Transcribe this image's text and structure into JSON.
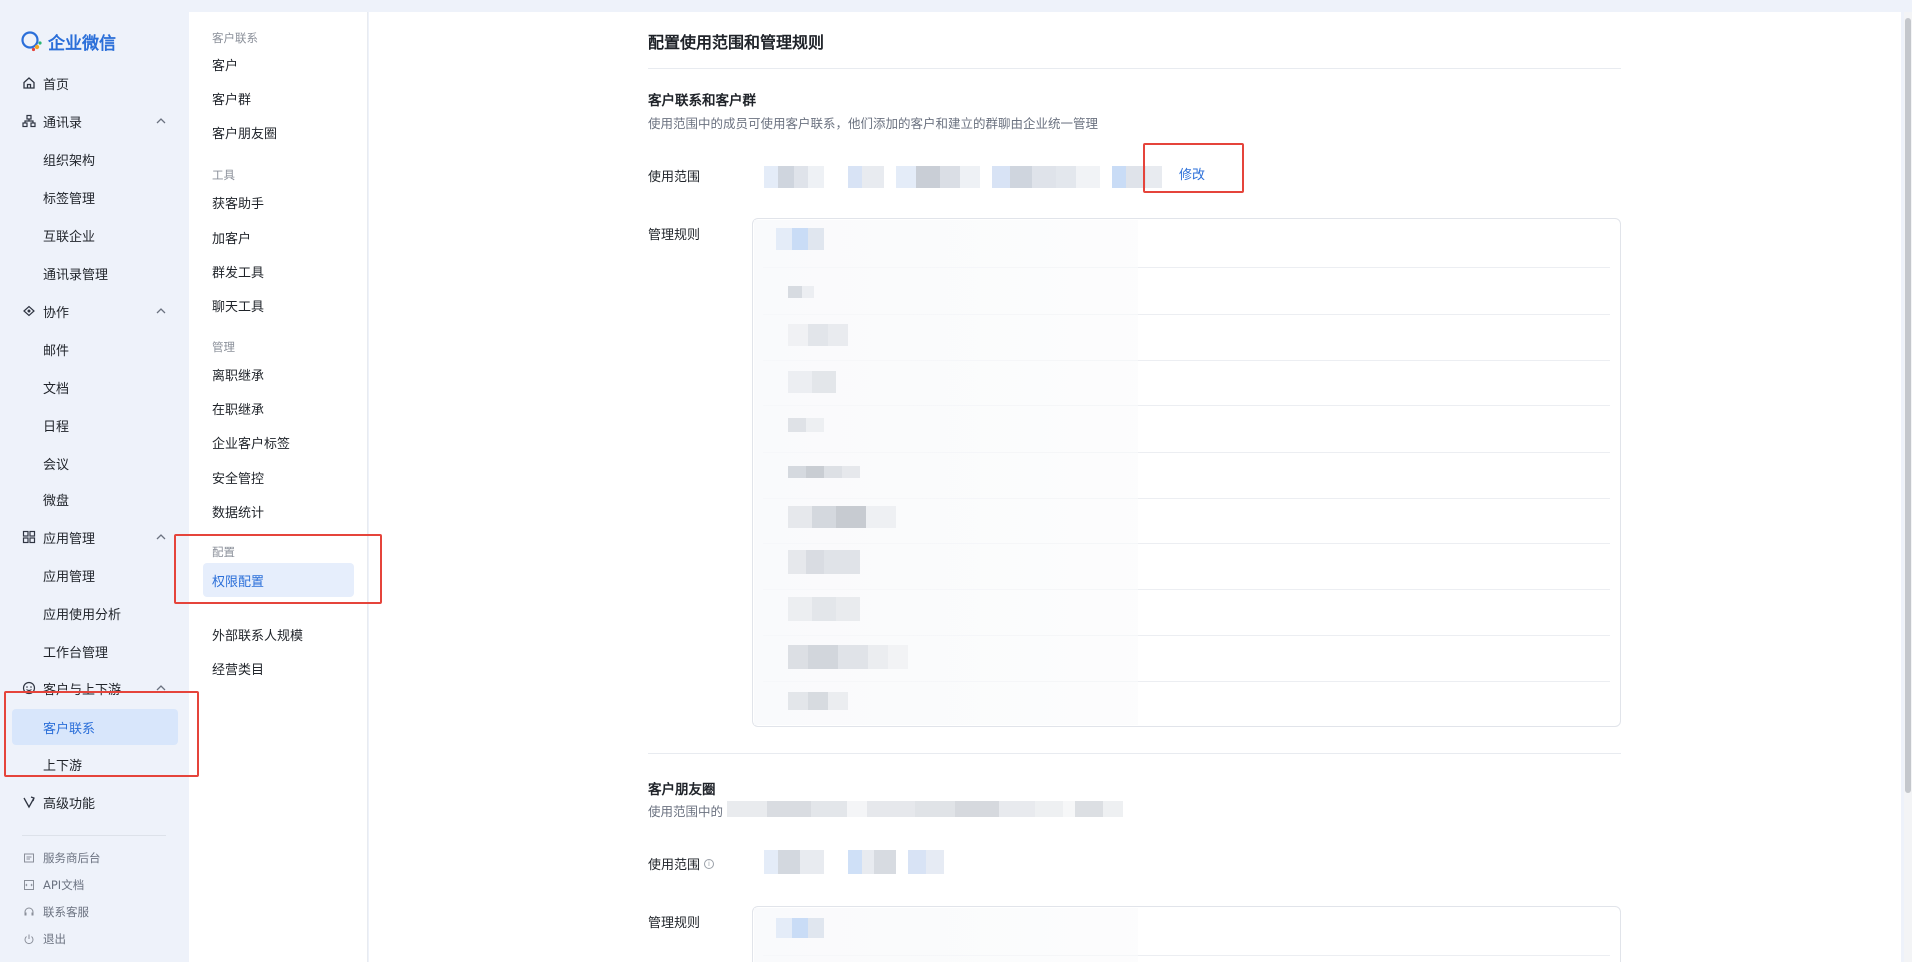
{
  "app": {
    "logo_text": "企业微信",
    "brand_color": "#2b6fd9",
    "highlight_color": "#e5443b"
  },
  "sidebar": {
    "items": [
      {
        "label": "首页",
        "icon": "home-icon"
      },
      {
        "label": "通讯录",
        "icon": "org-chart-icon",
        "expanded": true
      },
      {
        "label": "组织架构",
        "sub": true
      },
      {
        "label": "标签管理",
        "sub": true
      },
      {
        "label": "互联企业",
        "sub": true
      },
      {
        "label": "通讯录管理",
        "sub": true
      },
      {
        "label": "协作",
        "icon": "collaboration-icon",
        "expanded": true
      },
      {
        "label": "邮件",
        "sub": true
      },
      {
        "label": "文档",
        "sub": true
      },
      {
        "label": "日程",
        "sub": true
      },
      {
        "label": "会议",
        "sub": true
      },
      {
        "label": "微盘",
        "sub": true
      },
      {
        "label": "应用管理",
        "icon": "grid-icon",
        "expanded": true
      },
      {
        "label": "应用管理",
        "sub": true
      },
      {
        "label": "应用使用分析",
        "sub": true
      },
      {
        "label": "工作台管理",
        "sub": true
      },
      {
        "label": "客户与上下游",
        "icon": "customer-icon",
        "expanded": true
      },
      {
        "label": "客户联系",
        "sub": true,
        "active": true
      },
      {
        "label": "上下游",
        "sub": true
      },
      {
        "label": "高级功能",
        "icon": "advanced-icon"
      }
    ],
    "footer": [
      {
        "label": "服务商后台",
        "icon": "provider-icon"
      },
      {
        "label": "API文档",
        "icon": "api-icon"
      },
      {
        "label": "联系客服",
        "icon": "support-icon"
      },
      {
        "label": "退出",
        "icon": "power-icon"
      }
    ]
  },
  "sub_sidebar": {
    "groups": [
      {
        "title": "客户联系",
        "items": [
          "客户",
          "客户群",
          "客户朋友圈"
        ]
      },
      {
        "title": "工具",
        "items": [
          "获客助手",
          "加客户",
          "群发工具",
          "聊天工具"
        ]
      },
      {
        "title": "管理",
        "items": [
          "离职继承",
          "在职继承",
          "企业客户标签",
          "安全管控",
          "数据统计"
        ]
      },
      {
        "title": "配置",
        "items": [
          "权限配置"
        ]
      },
      {
        "title": "",
        "items": [
          "外部联系人规模",
          "经营类目"
        ]
      }
    ],
    "active_item": "权限配置"
  },
  "main": {
    "page_title": "配置使用范围和管理规则",
    "section1": {
      "title": "客户联系和客户群",
      "desc": "使用范围中的成员可使用客户联系，他们添加的客户和建立的群聊由企业统一管理",
      "scope_label": "使用范围",
      "edit_label": "修改",
      "rules_label": "管理规则"
    },
    "section2": {
      "title": "客户朋友圈",
      "desc": "使用范围中的",
      "scope_label": "使用范围",
      "info_icon_text": "i",
      "rules_label": "管理规则"
    }
  }
}
